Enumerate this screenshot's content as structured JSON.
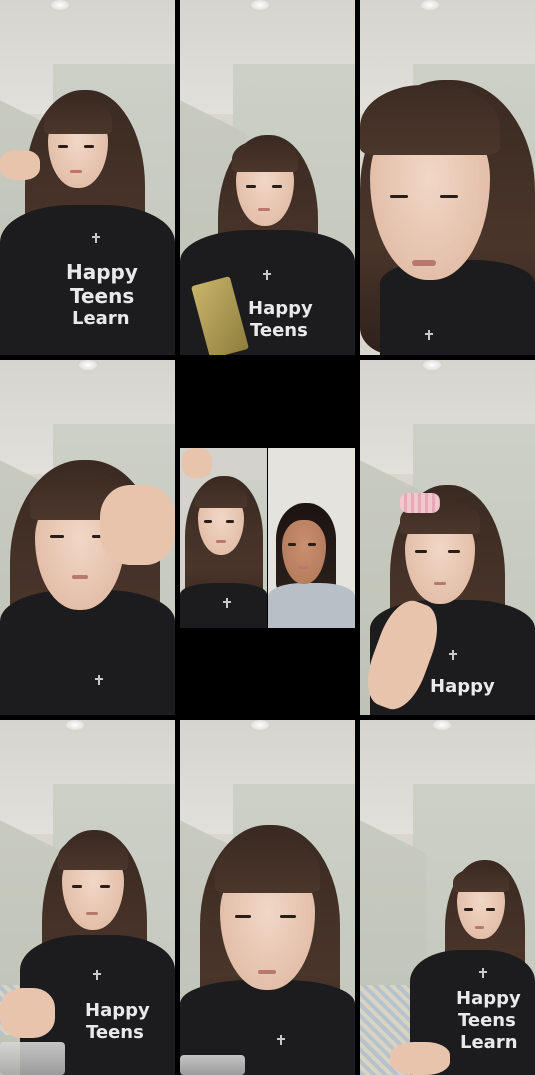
{
  "layout": {
    "description_rows": 3,
    "description_cols": 3
  },
  "tiles": [
    {
      "id": "tile-1",
      "shirt_lines": [
        "Happy",
        "Teens",
        "Learn"
      ],
      "has_hand": true,
      "has_snack": false,
      "has_roller": false
    },
    {
      "id": "tile-2",
      "shirt_lines": [
        "Happy",
        "Teens"
      ],
      "has_hand": false,
      "has_snack": true,
      "has_roller": false
    },
    {
      "id": "tile-3",
      "shirt_lines": [],
      "has_hand": false,
      "has_snack": false,
      "has_roller": false
    },
    {
      "id": "tile-4",
      "shirt_lines": [],
      "has_hand": true,
      "has_snack": false,
      "has_roller": false
    },
    {
      "id": "tile-5-duet",
      "shirt_lines": [],
      "has_hand": true,
      "has_snack": false,
      "has_roller": false
    },
    {
      "id": "tile-6",
      "shirt_lines": [
        "Happy"
      ],
      "has_hand": true,
      "has_snack": false,
      "has_roller": true
    },
    {
      "id": "tile-7",
      "shirt_lines": [
        "Happy",
        "Teens"
      ],
      "has_hand": true,
      "has_snack": false,
      "has_roller": false
    },
    {
      "id": "tile-8",
      "shirt_lines": [],
      "has_hand": false,
      "has_snack": false,
      "has_roller": false
    },
    {
      "id": "tile-9",
      "shirt_lines": [
        "Happy",
        "Teens",
        "Learn"
      ],
      "has_hand": true,
      "has_snack": false,
      "has_roller": false
    }
  ],
  "colors": {
    "background": "#000000",
    "shirt": "#1c1c1e",
    "hair": "#3a2a22",
    "wall": "#c9cbc0"
  }
}
